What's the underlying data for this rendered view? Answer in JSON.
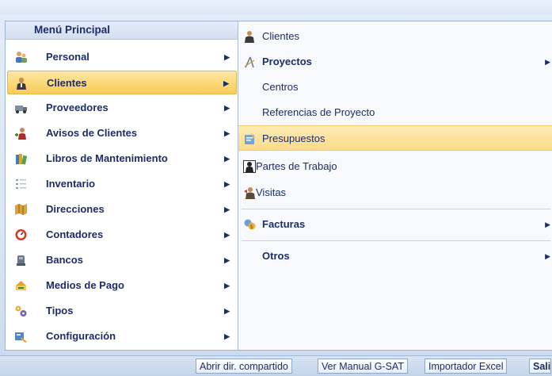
{
  "menu": {
    "title": "Menú Principal",
    "items": [
      {
        "label": "Personal",
        "icon": "people-icon"
      },
      {
        "label": "Clientes",
        "icon": "client-person-icon"
      },
      {
        "label": "Proveedores",
        "icon": "truck-icon"
      },
      {
        "label": "Avisos de Clientes",
        "icon": "alert-person-icon"
      },
      {
        "label": "Libros de Mantenimiento",
        "icon": "books-icon"
      },
      {
        "label": "Inventario",
        "icon": "inventory-list-icon"
      },
      {
        "label": "Direcciones",
        "icon": "map-icon"
      },
      {
        "label": "Contadores",
        "icon": "counter-gauge-icon"
      },
      {
        "label": "Bancos",
        "icon": "bank-icon"
      },
      {
        "label": "Medios de Pago",
        "icon": "payment-icon"
      },
      {
        "label": "Tipos",
        "icon": "gears-icon"
      },
      {
        "label": "Configuración",
        "icon": "configuration-icon"
      }
    ],
    "active_index": 1
  },
  "submenu": {
    "items": [
      {
        "label": "Clientes",
        "icon": "client-person-icon",
        "bold": false,
        "has_arrow": false
      },
      {
        "label": "Proyectos",
        "icon": "compass-icon",
        "bold": true,
        "has_arrow": true
      },
      {
        "label": "Centros",
        "icon": "",
        "bold": false,
        "has_arrow": false
      },
      {
        "label": "Referencias de Proyecto",
        "icon": "",
        "bold": false,
        "has_arrow": false
      },
      {
        "label": "Presupuestos",
        "icon": "budget-icon",
        "bold": false,
        "has_arrow": false
      },
      {
        "label": "Partes de Trabajo",
        "icon": "worker-icon",
        "bold": false,
        "has_arrow": false
      },
      {
        "label": "Visitas",
        "icon": "visit-icon",
        "bold": false,
        "has_arrow": false
      },
      {
        "label": "Facturas",
        "icon": "invoice-icon",
        "bold": true,
        "has_arrow": true
      },
      {
        "label": "Otros",
        "icon": "",
        "bold": true,
        "has_arrow": true
      }
    ],
    "active_index": 4
  },
  "bottom_buttons": [
    {
      "label": "Abrir dir. compartido"
    },
    {
      "label": "Ver Manual G-SAT"
    },
    {
      "label": "Importador Excel"
    },
    {
      "label": "Sali"
    }
  ],
  "colors": {
    "highlight": "#fbd776",
    "text": "#1b2d6b",
    "panel_border": "#a9bcd8"
  }
}
